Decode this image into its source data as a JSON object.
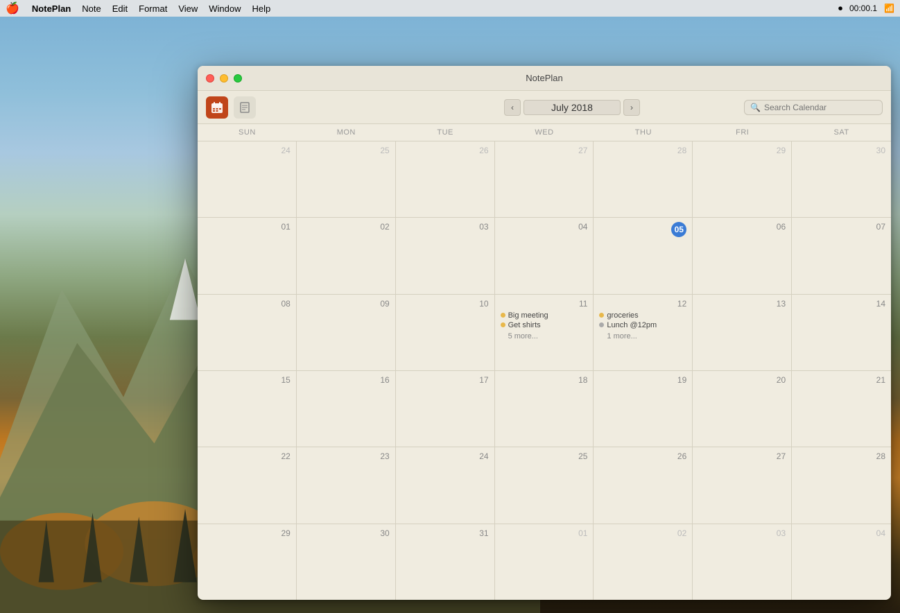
{
  "desktop": {
    "bg_label": "macOS Sierra Desktop"
  },
  "menubar": {
    "apple": "🍎",
    "app_name": "NotePlan",
    "menus": [
      "Note",
      "Edit",
      "Format",
      "View",
      "Window",
      "Help"
    ],
    "time": "00:00.1"
  },
  "window": {
    "title": "NotePlan",
    "toolbar": {
      "calendar_icon_label": "calendar",
      "note_icon_label": "note"
    },
    "month_nav": {
      "prev_label": "‹",
      "next_label": "›",
      "current_month": "July 2018"
    },
    "search": {
      "placeholder": "Search Calendar"
    }
  },
  "calendar": {
    "day_headers": [
      "SUN",
      "MON",
      "TUE",
      "WED",
      "THU",
      "FRI",
      "SAT"
    ],
    "weeks": [
      {
        "days": [
          {
            "num": "24",
            "other": true,
            "events": []
          },
          {
            "num": "25",
            "other": true,
            "events": []
          },
          {
            "num": "26",
            "other": true,
            "events": []
          },
          {
            "num": "27",
            "other": true,
            "events": []
          },
          {
            "num": "28",
            "other": true,
            "events": []
          },
          {
            "num": "29",
            "other": true,
            "events": []
          },
          {
            "num": "30",
            "other": true,
            "events": []
          }
        ]
      },
      {
        "days": [
          {
            "num": "01",
            "other": false,
            "events": []
          },
          {
            "num": "02",
            "other": false,
            "events": []
          },
          {
            "num": "03",
            "other": false,
            "events": []
          },
          {
            "num": "04",
            "other": false,
            "events": []
          },
          {
            "num": "05",
            "other": false,
            "today": true,
            "events": []
          },
          {
            "num": "06",
            "other": false,
            "events": []
          },
          {
            "num": "07",
            "other": false,
            "events": []
          }
        ]
      },
      {
        "days": [
          {
            "num": "08",
            "other": false,
            "events": []
          },
          {
            "num": "09",
            "other": false,
            "events": []
          },
          {
            "num": "10",
            "other": false,
            "events": []
          },
          {
            "num": "11",
            "other": false,
            "events": [
              {
                "label": "Big meeting",
                "dot": "yellow"
              },
              {
                "label": "Get shirts",
                "dot": "yellow"
              },
              {
                "more": "5 more..."
              }
            ]
          },
          {
            "num": "12",
            "other": false,
            "events": [
              {
                "label": "groceries",
                "dot": "yellow"
              },
              {
                "label": "Lunch @12pm",
                "dot": "gray"
              },
              {
                "more": "1 more..."
              }
            ]
          },
          {
            "num": "13",
            "other": false,
            "events": []
          },
          {
            "num": "14",
            "other": false,
            "events": []
          }
        ]
      },
      {
        "days": [
          {
            "num": "15",
            "other": false,
            "events": []
          },
          {
            "num": "16",
            "other": false,
            "events": []
          },
          {
            "num": "17",
            "other": false,
            "events": []
          },
          {
            "num": "18",
            "other": false,
            "events": []
          },
          {
            "num": "19",
            "other": false,
            "events": []
          },
          {
            "num": "20",
            "other": false,
            "events": []
          },
          {
            "num": "21",
            "other": false,
            "events": []
          }
        ]
      },
      {
        "days": [
          {
            "num": "22",
            "other": false,
            "events": []
          },
          {
            "num": "23",
            "other": false,
            "events": []
          },
          {
            "num": "24",
            "other": false,
            "events": []
          },
          {
            "num": "25",
            "other": false,
            "events": []
          },
          {
            "num": "26",
            "other": false,
            "events": []
          },
          {
            "num": "27",
            "other": false,
            "events": []
          },
          {
            "num": "28",
            "other": false,
            "events": []
          }
        ]
      },
      {
        "days": [
          {
            "num": "29",
            "other": false,
            "events": []
          },
          {
            "num": "30",
            "other": false,
            "events": []
          },
          {
            "num": "31",
            "other": false,
            "events": []
          },
          {
            "num": "01",
            "other": true,
            "events": []
          },
          {
            "num": "02",
            "other": true,
            "events": []
          },
          {
            "num": "03",
            "other": true,
            "events": []
          },
          {
            "num": "04",
            "other": true,
            "events": []
          }
        ]
      }
    ]
  }
}
